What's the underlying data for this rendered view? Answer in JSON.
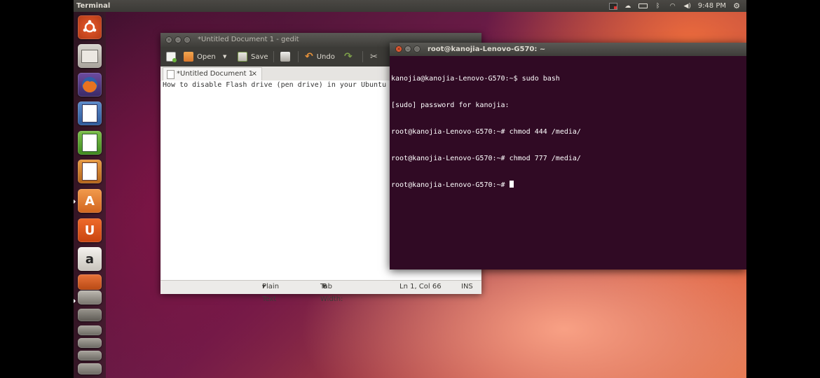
{
  "panel": {
    "app_title": "Terminal",
    "clock": "9:48 PM",
    "tray_icons": [
      "recording-icon",
      "cloud-icon",
      "battery-icon",
      "bluetooth-icon",
      "wifi-icon",
      "volume-icon",
      "power-gear-icon"
    ]
  },
  "launcher": {
    "items": [
      "dash-home",
      "files",
      "firefox",
      "libreoffice-writer",
      "libreoffice-calc",
      "libreoffice-impress",
      "software-center",
      "ubuntu-one",
      "amazon",
      "update-manager",
      "terminal",
      "workspaces",
      "trash"
    ],
    "software_center_glyph": "A",
    "ubuntu_one_glyph": "U",
    "amazon_glyph": "a"
  },
  "gedit": {
    "title": "*Untitled Document 1 - gedit",
    "toolbar": {
      "open_label": "Open",
      "save_label": "Save",
      "undo_label": "Undo"
    },
    "tab_label": "*Untitled Document 1",
    "tab_close": "×",
    "editor_text": "How to disable Flash drive (pen drive) in your Ubuntu",
    "status": {
      "language": "Plain Text",
      "tab_width_label": "Tab Width:",
      "tab_width_value": "8",
      "position": "Ln 1, Col 66",
      "mode": "INS"
    }
  },
  "terminal": {
    "title": "root@kanojia-Lenovo-G570: ~",
    "lines": [
      "kanojia@kanojia-Lenovo-G570:~$ sudo bash",
      "[sudo] password for kanojia:",
      "root@kanojia-Lenovo-G570:~# chmod 444 /media/",
      "root@kanojia-Lenovo-G570:~# chmod 777 /media/",
      "root@kanojia-Lenovo-G570:~# "
    ]
  },
  "colors": {
    "terminal_bg": "#300a24",
    "panel_bg": "#3c3b37",
    "close_button": "#e15a33"
  }
}
